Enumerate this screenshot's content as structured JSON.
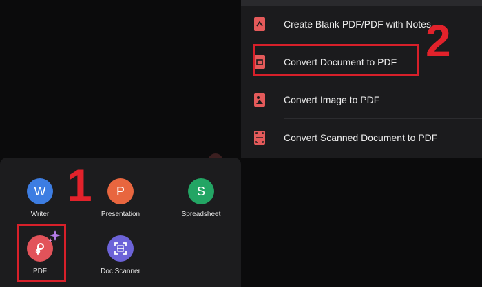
{
  "menu": {
    "items": [
      {
        "label": "Create Blank PDF/PDF with Notes",
        "icon": "blank-pdf-icon"
      },
      {
        "label": "Convert Document to PDF",
        "icon": "document-to-pdf-icon"
      },
      {
        "label": "Convert Image to PDF",
        "icon": "image-to-pdf-icon"
      },
      {
        "label": "Convert Scanned Document to PDF",
        "icon": "scan-to-pdf-icon"
      }
    ]
  },
  "sheet": {
    "apps": [
      {
        "label": "Writer",
        "letter": "W",
        "color": "#3d7de2"
      },
      {
        "label": "Presentation",
        "letter": "P",
        "color": "#e8663f"
      },
      {
        "label": "Spreadsheet",
        "letter": "S",
        "color": "#23a564"
      },
      {
        "label": "PDF",
        "letter": "",
        "color": "#e2535a"
      },
      {
        "label": "Doc Scanner",
        "letter": "",
        "color": "#6c63d8"
      }
    ]
  },
  "annotations": {
    "step1": "1",
    "step2": "2"
  },
  "colors": {
    "highlight": "#d7202a",
    "menu_icon": "#e45a5a",
    "sparkle": "#b47be6"
  }
}
